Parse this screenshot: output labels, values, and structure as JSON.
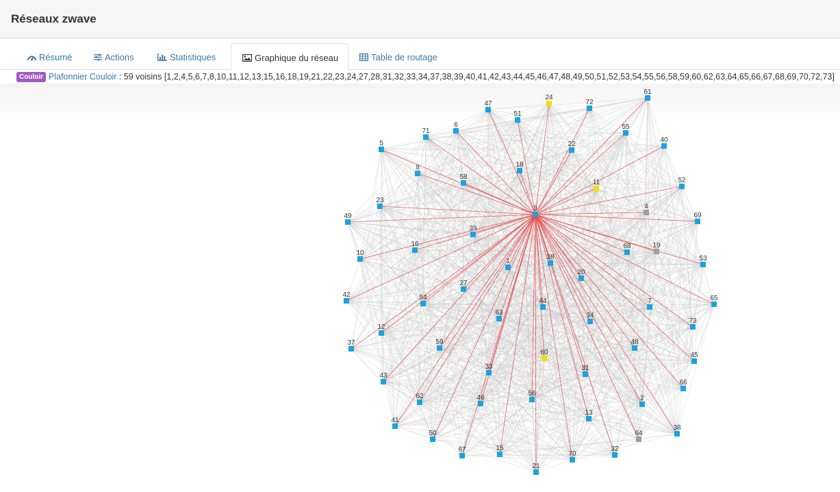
{
  "header": {
    "title": "Réseaux zwave"
  },
  "tabs": [
    {
      "label": "Résumé",
      "icon": "dashboard-icon",
      "active": false
    },
    {
      "label": "Actions",
      "icon": "sliders-icon",
      "active": false
    },
    {
      "label": "Statistiques",
      "icon": "bar-chart-icon",
      "active": false
    },
    {
      "label": "Graphique du réseau",
      "icon": "image-icon",
      "active": true
    },
    {
      "label": "Table de routage",
      "icon": "table-icon",
      "active": false
    }
  ],
  "info": {
    "badge": "Couloir",
    "device": "Plafonnier Couloir",
    "rest": " : 59 voisins [1,2,4,5,6,7,8,10,11,12,13,15,16,18,19,21,22,23,24,27,28,31,32,33,34,37,38,39,40,41,42,43,44,45,46,47,48,49,50,51,52,53,54,55,56,58,59,60,62,63,64,65,66,67,68,69,70,72,73]"
  },
  "colors": {
    "node_default": "#1aa3e0",
    "node_yellow": "#f2e100",
    "node_grey": "#9e9e9e",
    "edge": "#c8c8c8",
    "edge_selected": "#e64545",
    "badge": "#a05ac4",
    "link": "#3a79a6"
  },
  "network": {
    "selected": "3",
    "nodes": [
      {
        "id": "24",
        "color": "yellow"
      },
      {
        "id": "61"
      },
      {
        "id": "47"
      },
      {
        "id": "72"
      },
      {
        "id": "51"
      },
      {
        "id": "6"
      },
      {
        "id": "55"
      },
      {
        "id": "71"
      },
      {
        "id": "5"
      },
      {
        "id": "22"
      },
      {
        "id": "40"
      },
      {
        "id": "8"
      },
      {
        "id": "18"
      },
      {
        "id": "58"
      },
      {
        "id": "52"
      },
      {
        "id": "11",
        "color": "yellow"
      },
      {
        "id": "23"
      },
      {
        "id": "4",
        "color": "grey"
      },
      {
        "id": "3"
      },
      {
        "id": "49"
      },
      {
        "id": "69"
      },
      {
        "id": "39"
      },
      {
        "id": "16"
      },
      {
        "id": "68"
      },
      {
        "id": "19",
        "color": "grey"
      },
      {
        "id": "10"
      },
      {
        "id": "28"
      },
      {
        "id": "53"
      },
      {
        "id": "1"
      },
      {
        "id": "20"
      },
      {
        "id": "27"
      },
      {
        "id": "42"
      },
      {
        "id": "54"
      },
      {
        "id": "44"
      },
      {
        "id": "7"
      },
      {
        "id": "65"
      },
      {
        "id": "63"
      },
      {
        "id": "34"
      },
      {
        "id": "73"
      },
      {
        "id": "12"
      },
      {
        "id": "37"
      },
      {
        "id": "59"
      },
      {
        "id": "48"
      },
      {
        "id": "60",
        "color": "yellow"
      },
      {
        "id": "45"
      },
      {
        "id": "33"
      },
      {
        "id": "31"
      },
      {
        "id": "43"
      },
      {
        "id": "66"
      },
      {
        "id": "62"
      },
      {
        "id": "46"
      },
      {
        "id": "56"
      },
      {
        "id": "2"
      },
      {
        "id": "13"
      },
      {
        "id": "41"
      },
      {
        "id": "38"
      },
      {
        "id": "50"
      },
      {
        "id": "64",
        "color": "grey"
      },
      {
        "id": "67"
      },
      {
        "id": "15"
      },
      {
        "id": "70"
      },
      {
        "id": "32"
      },
      {
        "id": "21"
      }
    ]
  }
}
